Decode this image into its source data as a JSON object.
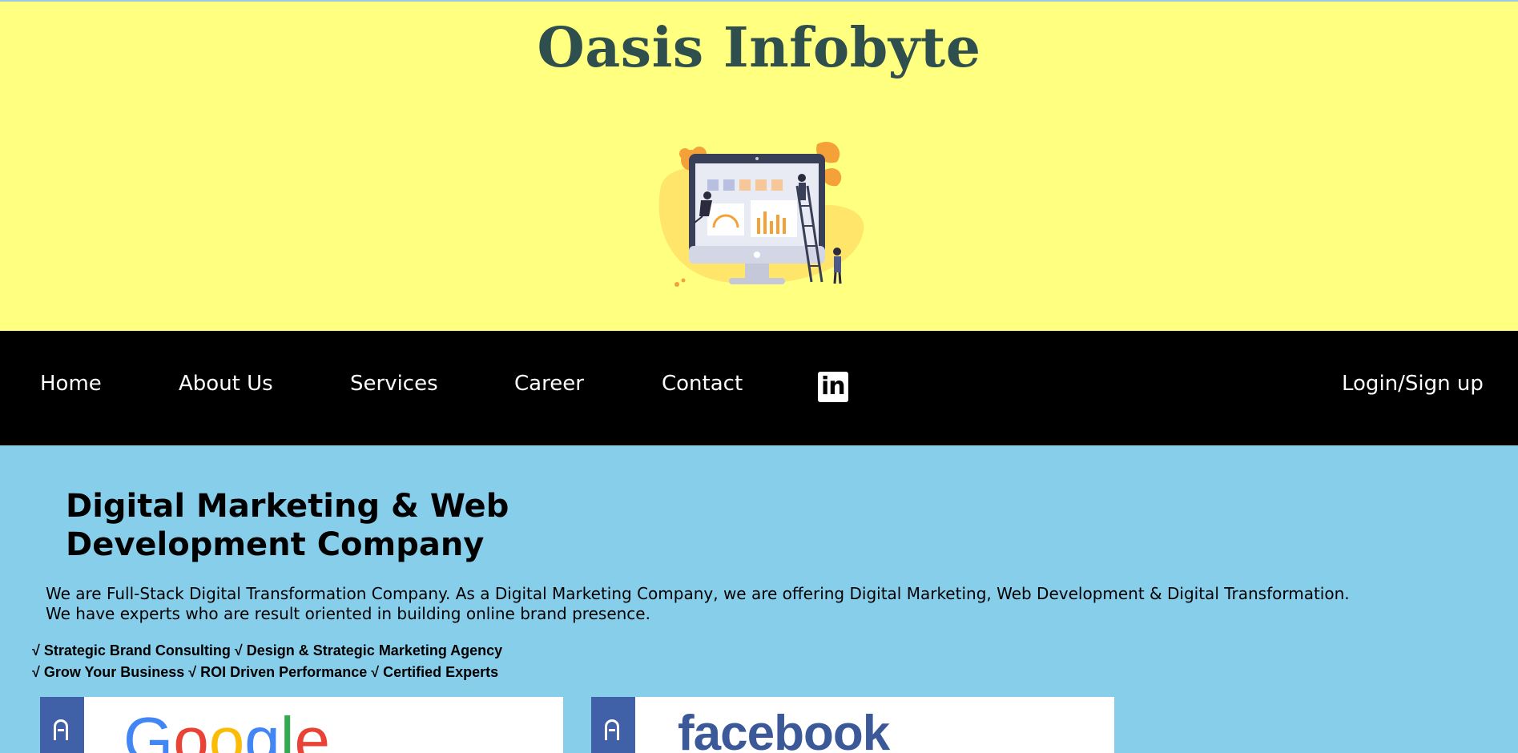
{
  "header": {
    "title": "Oasis Infobyte",
    "illustration": "computer-dashboard-illustration"
  },
  "nav": {
    "items": [
      {
        "label": "Home"
      },
      {
        "label": "About Us"
      },
      {
        "label": "Services"
      },
      {
        "label": "Career"
      },
      {
        "label": "Contact"
      }
    ],
    "social_icon": "linkedin-icon",
    "linkedin_text": "in",
    "login_label": "Login/Sign up"
  },
  "main": {
    "headline": "Digital Marketing & Web Development Company",
    "intro_line1": "We are Full-Stack Digital Transformation Company. As a Digital Marketing Company, we are offering Digital Marketing, Web Development & Digital Transformation.",
    "intro_line2": "We have experts who are result oriented in building online brand presence.",
    "features_line1": "√ Strategic Brand Consulting √ Design & Strategic Marketing Agency",
    "features_line2": "√ Grow Your Business √ ROI Driven Performance √ Certified Experts",
    "partners": [
      {
        "name": "Google",
        "icon": "badge-icon"
      },
      {
        "name": "facebook",
        "icon": "badge-icon"
      }
    ]
  },
  "colors": {
    "header_bg": "#ffff80",
    "title_color": "#2f4f4f",
    "nav_bg": "#000000",
    "main_bg": "#87ceeb",
    "badge_strip": "#4060a8",
    "facebook_blue": "#3b5998"
  }
}
